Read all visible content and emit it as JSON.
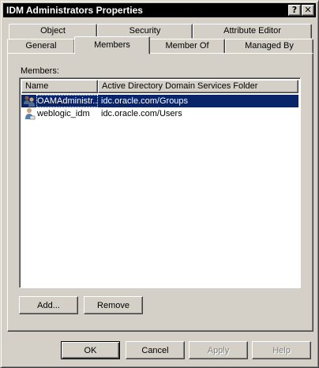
{
  "window": {
    "title": "IDM Administrators Properties"
  },
  "title_buttons": {
    "help": "?",
    "close": "✕"
  },
  "tabs_back": [
    {
      "label": "Object"
    },
    {
      "label": "Security"
    },
    {
      "label": "Attribute Editor"
    }
  ],
  "tabs_front": [
    {
      "label": "General"
    },
    {
      "label": "Members"
    },
    {
      "label": "Member Of"
    },
    {
      "label": "Managed By"
    }
  ],
  "members": {
    "label": "Members:",
    "columns": [
      "Name",
      "Active Directory Domain Services Folder"
    ],
    "rows": [
      {
        "name": "OAMAdministr...",
        "folder": "idc.oracle.com/Groups",
        "icon": "group-icon",
        "selected": true
      },
      {
        "name": "weblogic_idm",
        "folder": "idc.oracle.com/Users",
        "icon": "user-icon",
        "selected": false
      }
    ],
    "add_label": "Add...",
    "remove_label": "Remove"
  },
  "footer": {
    "ok_label": "OK",
    "cancel_label": "Cancel",
    "apply_label": "Apply",
    "help_label": "Help"
  }
}
